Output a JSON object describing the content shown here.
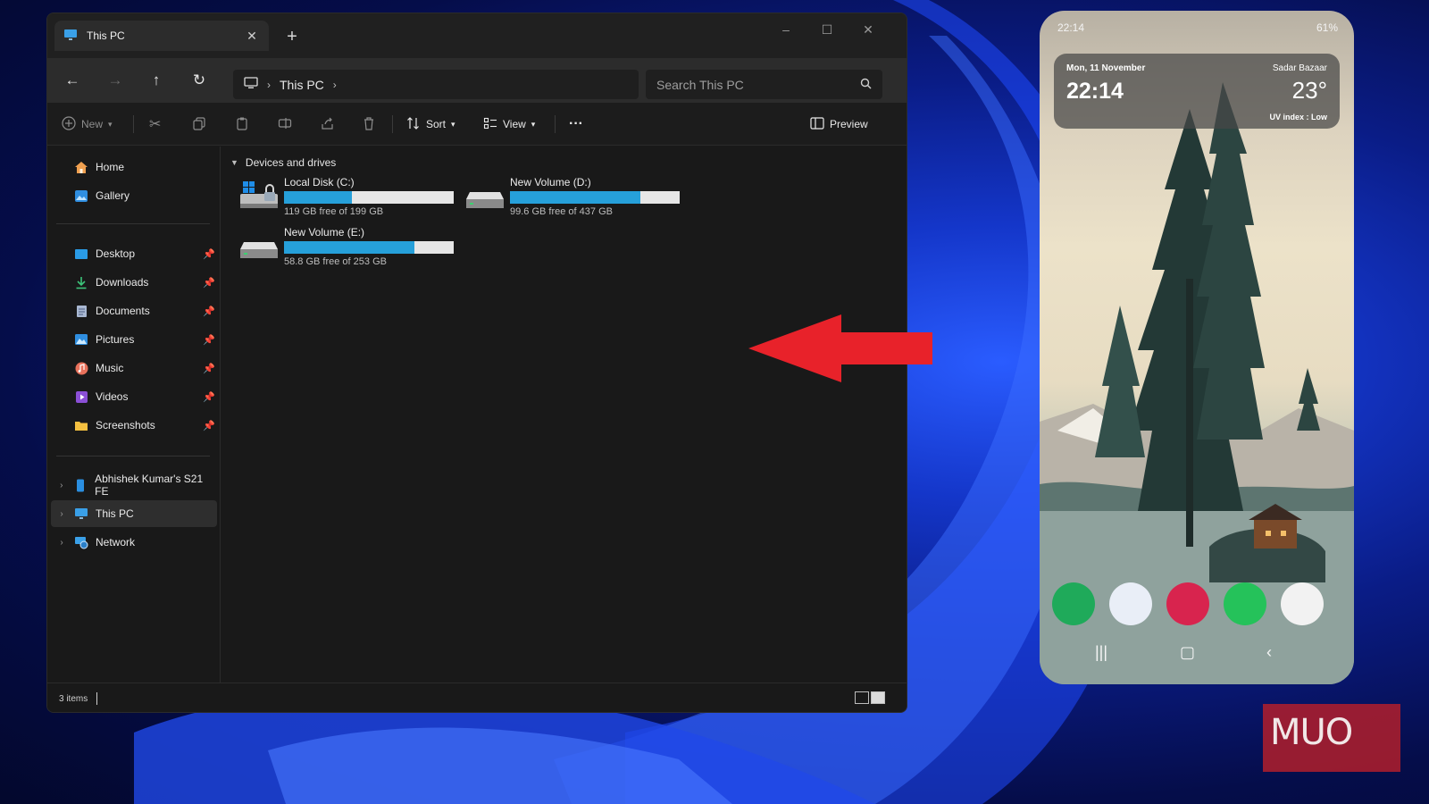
{
  "explorer": {
    "tab_title": "This PC",
    "address": {
      "location": "This PC"
    },
    "search": {
      "placeholder": "Search This PC"
    },
    "toolbar": {
      "new_label": "New",
      "sort_label": "Sort",
      "view_label": "View",
      "more_label": "···",
      "preview_label": "Preview"
    },
    "sidebar": {
      "home": "Home",
      "gallery": "Gallery",
      "desktop": "Desktop",
      "downloads": "Downloads",
      "documents": "Documents",
      "pictures": "Pictures",
      "music": "Music",
      "videos": "Videos",
      "screenshots": "Screenshots",
      "phone": "Abhishek Kumar's S21 FE",
      "this_pc": "This PC",
      "network": "Network"
    },
    "group_header": "Devices and drives",
    "drives": [
      {
        "name": "Local Disk (C:)",
        "free_text": "119 GB free of 199 GB",
        "used_fraction": 0.4
      },
      {
        "name": "New Volume (D:)",
        "free_text": "99.6 GB free of 437 GB",
        "used_fraction": 0.77
      },
      {
        "name": "New Volume (E:)",
        "free_text": "58.8 GB free of 253 GB",
        "used_fraction": 0.77
      }
    ],
    "status": {
      "item_count": "3 items"
    }
  },
  "phone": {
    "status_time": "22:14",
    "battery": "61%",
    "widget": {
      "date": "Mon, 11 November",
      "time": "22:14",
      "location": "Sadar Bazaar",
      "temperature": "23°",
      "uv": "UV index : Low"
    }
  },
  "watermark": "MUO",
  "colors": {
    "storage_bar": "#26a0da",
    "arrow": "#e8222a",
    "accent_wallpaper": "#1436c9"
  }
}
